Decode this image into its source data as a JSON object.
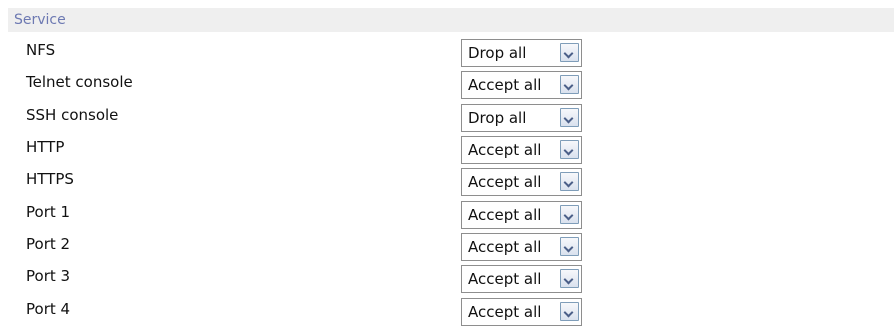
{
  "section": {
    "title": "Service"
  },
  "services": [
    {
      "label": "NFS",
      "value": "Drop all"
    },
    {
      "label": "Telnet console",
      "value": "Accept all"
    },
    {
      "label": "SSH console",
      "value": "Drop all"
    },
    {
      "label": "HTTP",
      "value": "Accept all"
    },
    {
      "label": "HTTPS",
      "value": "Accept all"
    },
    {
      "label": "Port 1",
      "value": "Accept all"
    },
    {
      "label": "Port 2",
      "value": "Accept all"
    },
    {
      "label": "Port 3",
      "value": "Accept all"
    },
    {
      "label": "Port 4",
      "value": "Accept all"
    }
  ],
  "icons": {
    "dropdown": "chevron-down-icon"
  },
  "colors": {
    "header_text": "#6d79b2",
    "header_background": "#efefef",
    "dropdown_border": "#8e8e8e"
  }
}
